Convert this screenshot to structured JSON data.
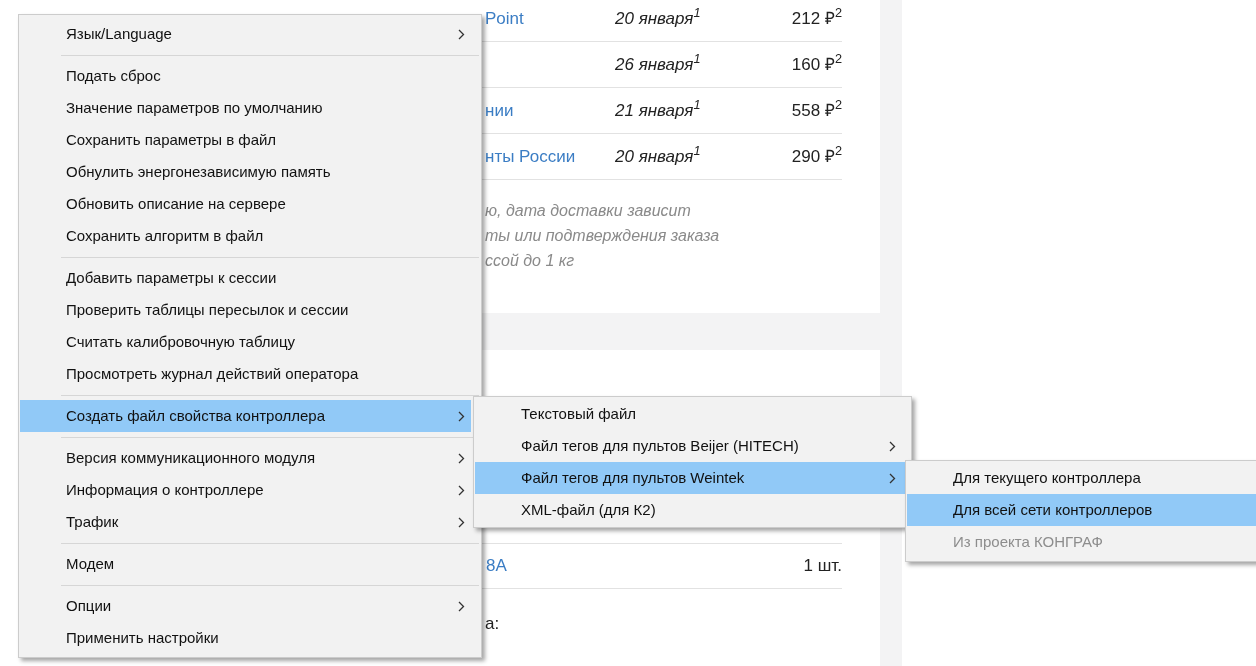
{
  "page": {
    "delivery_rows": [
      {
        "carrier": "Point",
        "date": "20 января$^{1}$",
        "price": "212 ₽$^{2}$"
      },
      {
        "carrier": "",
        "date": "26 января$^{1}$",
        "price": "160 ₽$^{2}$"
      },
      {
        "carrier": "нии",
        "date": "21 января$^{1}$",
        "price": "558 ₽$^{2}$"
      },
      {
        "carrier": "нты России",
        "date": "20 января$^{1}$",
        "price": "290 ₽$^{2}$"
      }
    ],
    "note_lines": [
      "ю, дата доставки зависит",
      "ты или подтверждения заказа",
      "ссой до 1 кг"
    ],
    "product": {
      "name": "8A",
      "quantity": "1 шт."
    },
    "caption": "а:"
  },
  "menus": [
    {
      "items": [
        {
          "kind": "item",
          "label": "Язык/Language",
          "submenu": true,
          "selected": false,
          "disabled": false
        },
        {
          "kind": "separator"
        },
        {
          "kind": "item",
          "label": "Подать сброс",
          "submenu": false,
          "selected": false,
          "disabled": false
        },
        {
          "kind": "item",
          "label": "Значение параметров по умолчанию",
          "submenu": false,
          "selected": false,
          "disabled": false
        },
        {
          "kind": "item",
          "label": "Сохранить параметры в файл",
          "submenu": false,
          "selected": false,
          "disabled": false
        },
        {
          "kind": "item",
          "label": "Обнулить энергонезависимую память",
          "submenu": false,
          "selected": false,
          "disabled": false
        },
        {
          "kind": "item",
          "label": "Обновить описание на сервере",
          "submenu": false,
          "selected": false,
          "disabled": false
        },
        {
          "kind": "item",
          "label": "Сохранить алгоритм в файл",
          "submenu": false,
          "selected": false,
          "disabled": false
        },
        {
          "kind": "separator"
        },
        {
          "kind": "item",
          "label": "Добавить параметры к сессии",
          "submenu": false,
          "selected": false,
          "disabled": false
        },
        {
          "kind": "item",
          "label": "Проверить таблицы пересылок и сессии",
          "submenu": false,
          "selected": false,
          "disabled": false
        },
        {
          "kind": "item",
          "label": "Считать калибровочную таблицу",
          "submenu": false,
          "selected": false,
          "disabled": false
        },
        {
          "kind": "item",
          "label": "Просмотреть журнал действий оператора",
          "submenu": false,
          "selected": false,
          "disabled": false
        },
        {
          "kind": "separator"
        },
        {
          "kind": "item",
          "label": "Создать файл свойства контроллера",
          "submenu": true,
          "selected": true,
          "disabled": false
        },
        {
          "kind": "separator"
        },
        {
          "kind": "item",
          "label": "Версия коммуникационного модуля",
          "submenu": true,
          "selected": false,
          "disabled": false
        },
        {
          "kind": "item",
          "label": "Информация о контроллере",
          "submenu": true,
          "selected": false,
          "disabled": false
        },
        {
          "kind": "item",
          "label": "Трафик",
          "submenu": true,
          "selected": false,
          "disabled": false
        },
        {
          "kind": "separator"
        },
        {
          "kind": "item",
          "label": "Модем",
          "submenu": false,
          "selected": false,
          "disabled": false
        },
        {
          "kind": "separator"
        },
        {
          "kind": "item",
          "label": "Опции",
          "submenu": true,
          "selected": false,
          "disabled": false
        },
        {
          "kind": "item",
          "label": "Применить настройки",
          "submenu": false,
          "selected": false,
          "disabled": false
        }
      ]
    },
    {
      "items": [
        {
          "kind": "item",
          "label": "Текстовый файл",
          "submenu": false,
          "selected": false,
          "disabled": false
        },
        {
          "kind": "item",
          "label": "Файл тегов для пультов Beijer (HITECH)",
          "submenu": true,
          "selected": false,
          "disabled": false
        },
        {
          "kind": "item",
          "label": "Файл тегов для пультов Weintek",
          "submenu": true,
          "selected": true,
          "disabled": false
        },
        {
          "kind": "item",
          "label": "XML-файл (для К2)",
          "submenu": false,
          "selected": false,
          "disabled": false
        }
      ]
    },
    {
      "items": [
        {
          "kind": "item",
          "label": "Для текущего контроллера",
          "submenu": false,
          "selected": false,
          "disabled": false
        },
        {
          "kind": "item",
          "label": "Для всей сети контроллеров",
          "submenu": false,
          "selected": true,
          "disabled": false
        },
        {
          "kind": "item",
          "label": "Из проекта КОНГРАФ",
          "submenu": false,
          "selected": false,
          "disabled": true
        }
      ]
    }
  ]
}
